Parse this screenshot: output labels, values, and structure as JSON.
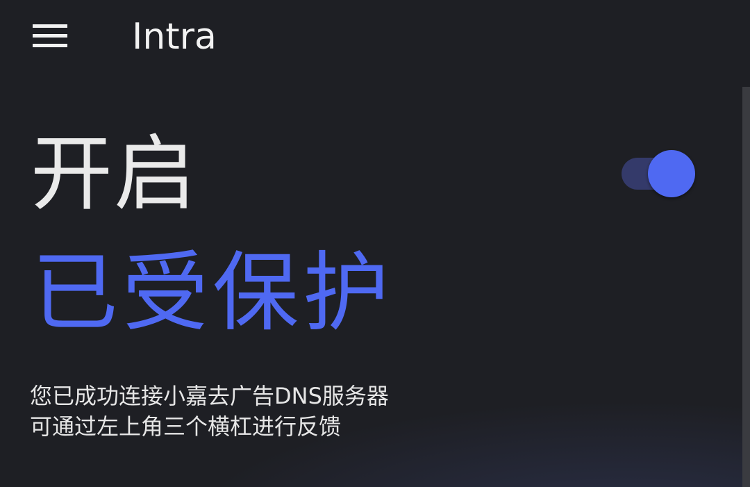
{
  "app_bar": {
    "menu_icon": "hamburger-menu-icon",
    "title": "Intra"
  },
  "main": {
    "state_label": "开启",
    "status_label": "已受保护",
    "toggle": {
      "checked": true,
      "accent_color": "#4f69f2",
      "track_color": "#343a6a"
    },
    "description_lines": [
      "您已成功连接小嘉去广告DNS服务器",
      "可通过左上角三个横杠进行反馈"
    ]
  },
  "theme": {
    "background": "#1e1f24",
    "text_primary": "#eaeaea",
    "accent": "#4f69f2"
  }
}
